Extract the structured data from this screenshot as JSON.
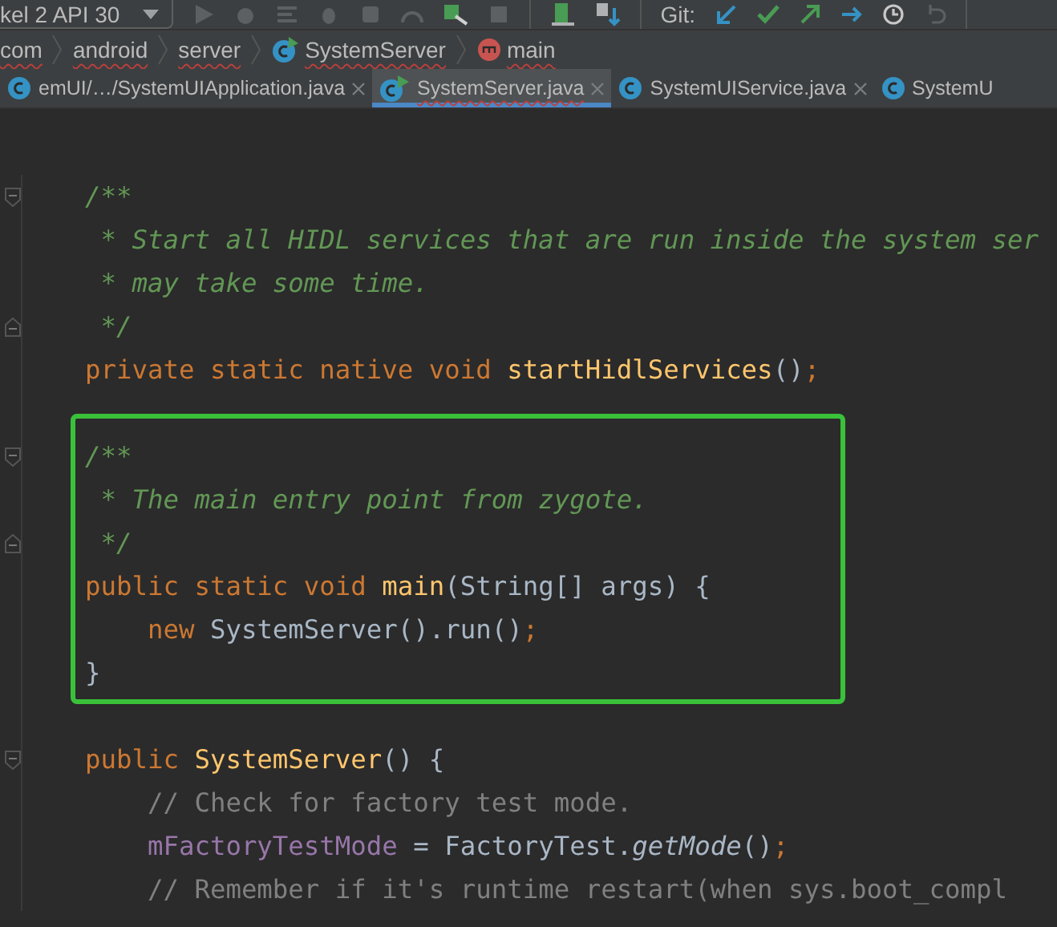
{
  "toolbar": {
    "device": "kel 2 API 30",
    "git_label": "Git:"
  },
  "breadcrumb": [
    {
      "text": "com",
      "kind": "plain"
    },
    {
      "text": "android",
      "kind": "plain"
    },
    {
      "text": "server",
      "kind": "plain"
    },
    {
      "text": "SystemServer",
      "kind": "class"
    },
    {
      "text": "main",
      "kind": "method"
    }
  ],
  "tabs": [
    {
      "label": "emUI/…/SystemUIApplication.java",
      "kind": "class",
      "selected": false,
      "closable": true
    },
    {
      "label": "SystemServer.java",
      "kind": "runnable",
      "selected": true,
      "closable": true
    },
    {
      "label": "SystemUIService.java",
      "kind": "class",
      "selected": false,
      "closable": true
    },
    {
      "label": "SystemU",
      "kind": "class",
      "selected": false,
      "closable": false
    }
  ],
  "code": [
    {
      "lines": [
        {
          "fold_start": true,
          "tokens": [
            {
              "text": "    /**",
              "kind": "doc"
            }
          ]
        },
        {
          "tokens": [
            {
              "text": "     * Start all HIDL services that are run inside the system ser",
              "kind": "doc"
            }
          ]
        },
        {
          "tokens": [
            {
              "text": "     * may take some time.",
              "kind": "doc"
            }
          ]
        },
        {
          "fold_end": true,
          "tokens": [
            {
              "text": "     */",
              "kind": "doc"
            }
          ]
        },
        {
          "tokens": [
            {
              "text": "    private static native void ",
              "kind": "kw"
            },
            {
              "text": "startHidlServices",
              "kind": "fn"
            },
            {
              "text": "()",
              "kind": "plain"
            },
            {
              "text": ";",
              "kind": "kw"
            }
          ]
        }
      ]
    },
    {
      "highlighted": true,
      "lines": [
        {
          "fold_start": true,
          "tokens": [
            {
              "text": "    /**",
              "kind": "doc"
            }
          ]
        },
        {
          "tokens": [
            {
              "text": "     * The main entry point from zygote.",
              "kind": "doc"
            }
          ]
        },
        {
          "fold_end": true,
          "tokens": [
            {
              "text": "     */",
              "kind": "doc"
            }
          ]
        },
        {
          "tokens": [
            {
              "text": "    public static void ",
              "kind": "kw"
            },
            {
              "text": "main",
              "kind": "fn"
            },
            {
              "text": "(String[] args) {",
              "kind": "plain"
            }
          ]
        },
        {
          "tokens": [
            {
              "text": "        new ",
              "kind": "kw"
            },
            {
              "text": "SystemServer().run()",
              "kind": "plain"
            },
            {
              "text": ";",
              "kind": "kw"
            }
          ]
        },
        {
          "tokens": [
            {
              "text": "    }",
              "kind": "plain"
            }
          ]
        }
      ]
    },
    {
      "lines": [
        {
          "fold_start": true,
          "tokens": [
            {
              "text": "    public ",
              "kind": "kw"
            },
            {
              "text": "SystemServer",
              "kind": "fn"
            },
            {
              "text": "() {",
              "kind": "plain"
            }
          ]
        },
        {
          "tokens": [
            {
              "text": "        // Check for factory test mode.",
              "kind": "cmt"
            }
          ]
        },
        {
          "tokens": [
            {
              "text": "        mFactoryTestMode",
              "kind": "field"
            },
            {
              "text": " = FactoryTest.",
              "kind": "plain"
            },
            {
              "text": "getMode",
              "kind": "static"
            },
            {
              "text": "()",
              "kind": "plain"
            },
            {
              "text": ";",
              "kind": "kw"
            }
          ]
        },
        {
          "tokens": [
            {
              "text": "        // Remember if it's runtime restart(when sys.boot_compl",
              "kind": "cmt"
            }
          ]
        }
      ]
    }
  ]
}
